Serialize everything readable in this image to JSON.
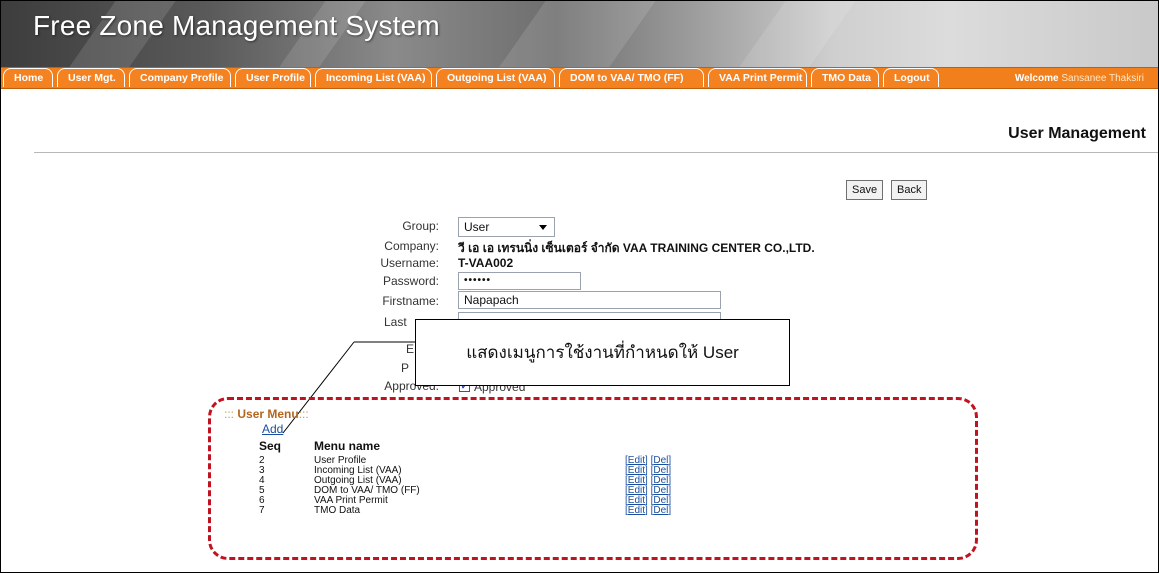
{
  "app": {
    "title": "Free Zone Management System"
  },
  "nav": {
    "tabs": [
      {
        "label": "Home"
      },
      {
        "label": "User Mgt."
      },
      {
        "label": "Company Profile"
      },
      {
        "label": "User Profile"
      },
      {
        "label": "Incoming List (VAA)"
      },
      {
        "label": "Outgoing List (VAA)"
      },
      {
        "label": "DOM to VAA/ TMO (FF)"
      },
      {
        "label": "VAA Print Permit"
      },
      {
        "label": "TMO Data"
      },
      {
        "label": "Logout"
      }
    ],
    "welcome_label": "Welcome",
    "welcome_user": "Sansanee Thaksiri"
  },
  "page": {
    "heading": "User Management",
    "save_label": "Save",
    "back_label": "Back"
  },
  "form": {
    "group_label": "Group:",
    "group_value": "User",
    "company_label": "Company:",
    "company_value": "วี เอ เอ เทรนนิ่ง เซ็นเตอร์ จำกัด VAA TRAINING CENTER CO.,LTD.",
    "username_label": "Username:",
    "username_value": "T-VAA002",
    "password_label": "Password:",
    "password_value": "••••••",
    "firstname_label": "Firstname:",
    "firstname_value": "Napapach",
    "lastname_label": "Last",
    "field_e_label": "E",
    "field_p_label": "P",
    "approved_label": "Approved:",
    "approved_checkbox_text": "Approved",
    "approved_checked": true
  },
  "callout": {
    "text": "แสดงเมนูการใช้งานที่กำหนดให้ User"
  },
  "user_menu": {
    "legend_prefix": ":::",
    "legend_title": "User Menu",
    "legend_suffix": ":::",
    "add_label": "Add",
    "col_seq": "Seq",
    "col_menu": "Menu name",
    "edit_label": "Edit",
    "del_label": "Del",
    "rows": [
      {
        "seq": "2",
        "name": "User Profile"
      },
      {
        "seq": "3",
        "name": "Incoming List (VAA)"
      },
      {
        "seq": "4",
        "name": "Outgoing List (VAA)"
      },
      {
        "seq": "5",
        "name": "DOM to VAA/ TMO (FF)"
      },
      {
        "seq": "6",
        "name": "VAA Print Permit"
      },
      {
        "seq": "7",
        "name": "TMO Data"
      }
    ]
  },
  "colors": {
    "nav_orange": "#f17f1b",
    "highlight_red": "#c1121f",
    "link_blue": "#1a4fa0",
    "legend_brown": "#b5651d"
  },
  "icons": {
    "dropdown": "chevron-down-icon",
    "checkbox": "checkbox-checked-icon"
  }
}
